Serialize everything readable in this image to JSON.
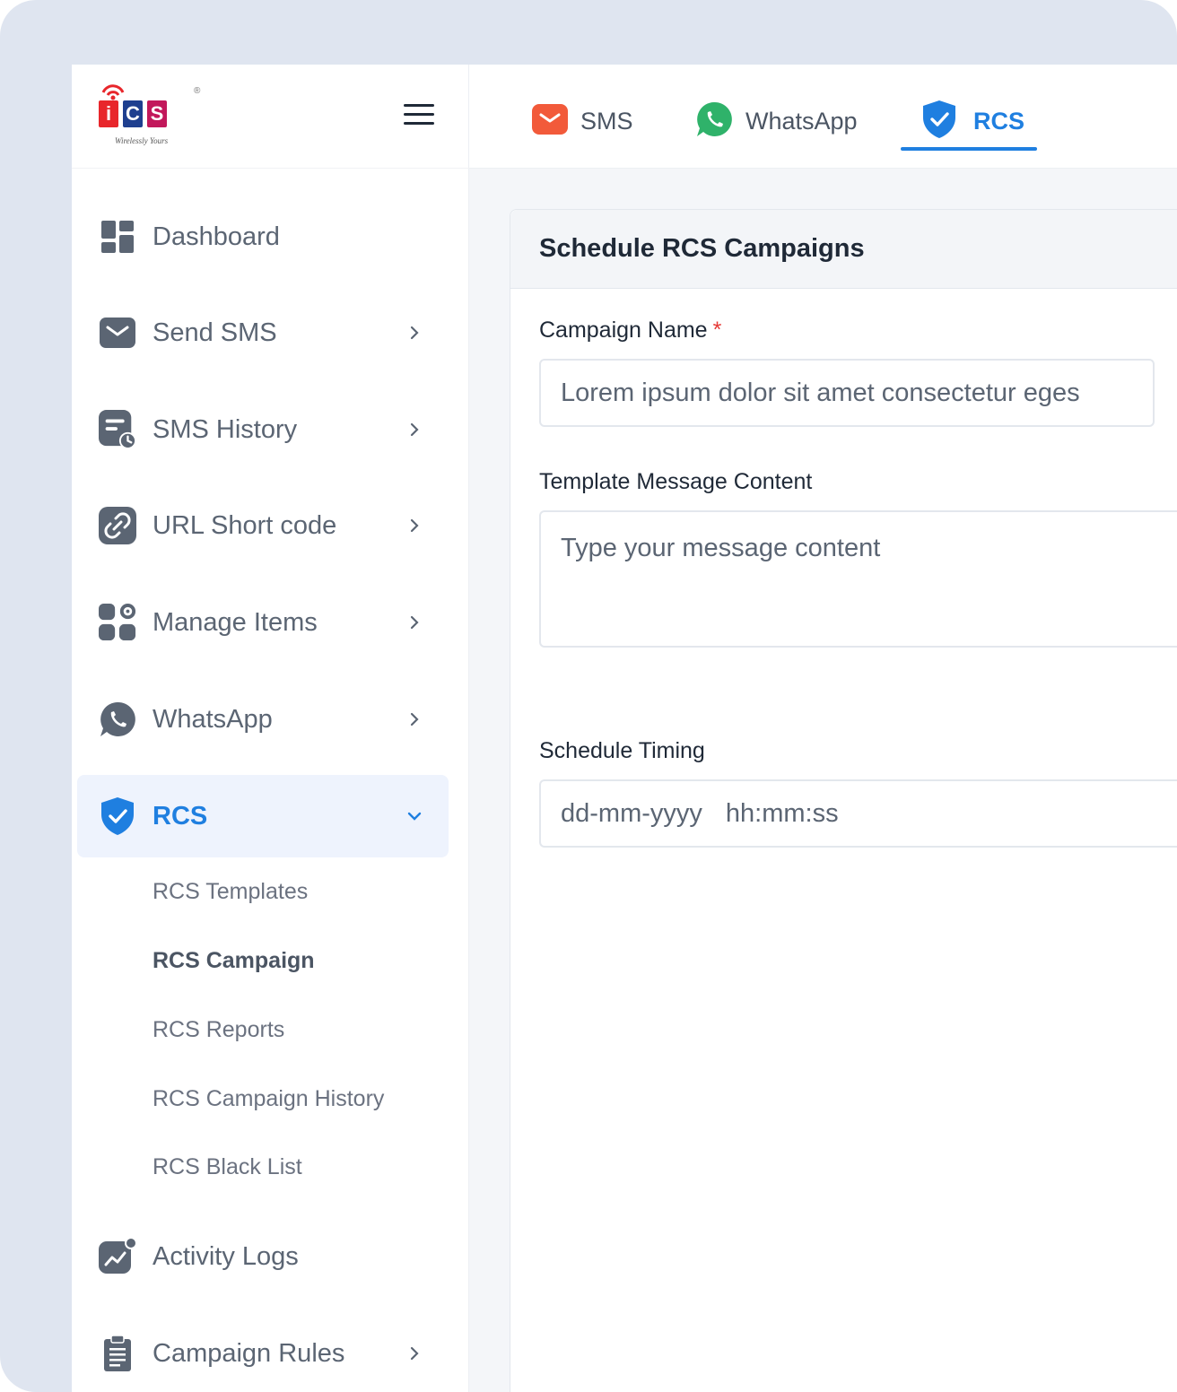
{
  "brand": {
    "letters": [
      "i",
      "C",
      "S"
    ],
    "letter_colors": [
      "#e8262b",
      "#1e3f8f",
      "#c2185b"
    ],
    "tagline": "Wirelessly Yours",
    "registered": "®"
  },
  "sidebar": {
    "items": [
      {
        "label": "Dashboard",
        "icon": "dashboard-icon",
        "has_chevron": false
      },
      {
        "label": "Send SMS",
        "icon": "mail-icon",
        "has_chevron": true
      },
      {
        "label": "SMS History",
        "icon": "sms-history-icon",
        "has_chevron": true
      },
      {
        "label": "URL Short code",
        "icon": "link-icon",
        "has_chevron": true
      },
      {
        "label": "Manage Items",
        "icon": "manage-items-icon",
        "has_chevron": true
      },
      {
        "label": "WhatsApp",
        "icon": "whatsapp-icon",
        "has_chevron": true
      },
      {
        "label": "RCS",
        "icon": "shield-check-icon",
        "has_chevron": true,
        "expanded": true,
        "active": true
      },
      {
        "label": "Activity Logs",
        "icon": "activity-icon",
        "has_chevron": false
      },
      {
        "label": "Campaign Rules",
        "icon": "clipboard-icon",
        "has_chevron": true
      }
    ],
    "rcs_submenu": [
      {
        "label": "RCS Templates"
      },
      {
        "label": "RCS Campaign",
        "current": true
      },
      {
        "label": "RCS Reports"
      },
      {
        "label": "RCS Campaign History"
      },
      {
        "label": "RCS Black List"
      }
    ]
  },
  "topbar": {
    "tabs": [
      {
        "label": "SMS",
        "icon": "sms-mail-icon"
      },
      {
        "label": "WhatsApp",
        "icon": "whatsapp-icon"
      },
      {
        "label": "RCS",
        "icon": "shield-check-icon",
        "active": true
      }
    ]
  },
  "form": {
    "title": "Schedule RCS Campaigns",
    "campaign_name_label": "Campaign Name",
    "required_mark": "*",
    "campaign_name_value": "Lorem ipsum dolor sit amet consectetur eges",
    "template_label": "Template Message Content",
    "template_placeholder": "Type your message content",
    "schedule_label": "Schedule Timing",
    "schedule_date_placeholder": "dd-mm-yyyy",
    "schedule_time_placeholder": "hh:mm:ss"
  },
  "colors": {
    "accent": "#1f7fe0",
    "required": "#e53935",
    "whatsapp": "#2fb26a",
    "sms": "#f25a3a"
  }
}
